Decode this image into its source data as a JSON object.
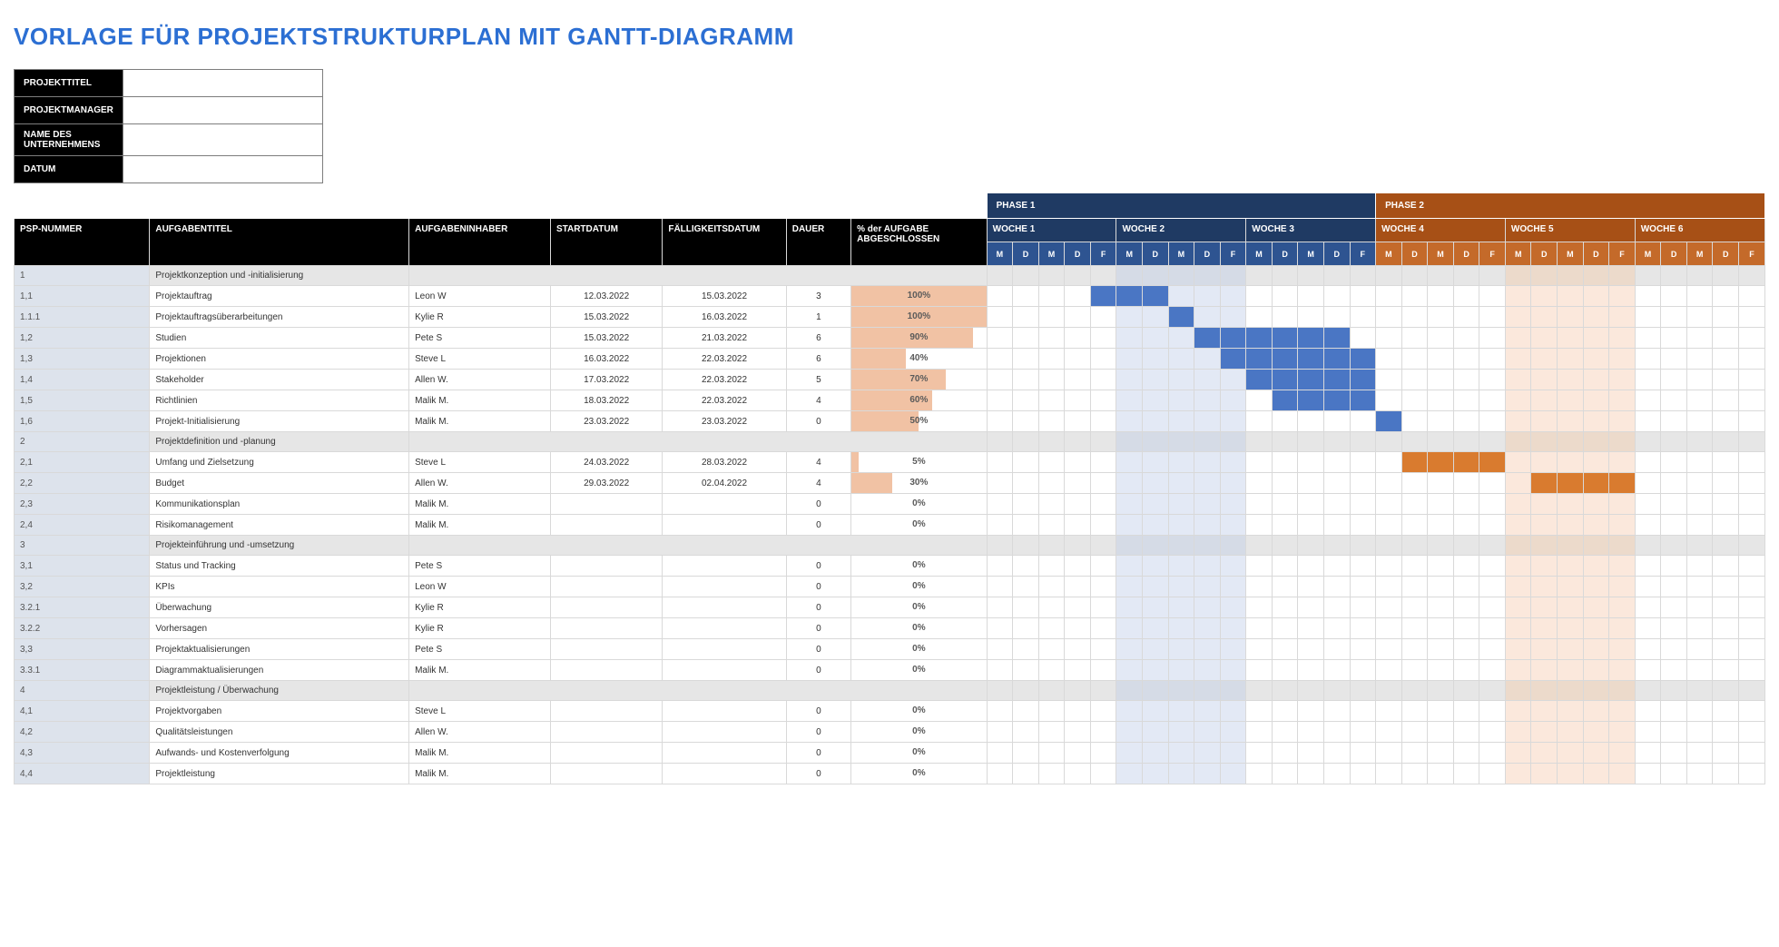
{
  "title": "VORLAGE FÜR PROJEKTSTRUKTURPLAN MIT GANTT-DIAGRAMM",
  "meta_labels": {
    "project_title": "PROJEKTTITEL",
    "project_manager": "PROJEKTMANAGER",
    "company_name": "NAME DES UNTERNEHMENS",
    "date": "DATUM"
  },
  "meta_values": {
    "project_title": "",
    "project_manager": "",
    "company_name": "",
    "date": ""
  },
  "phases": {
    "phase1": "PHASE 1",
    "phase2": "PHASE 2"
  },
  "columns": {
    "psp": "PSP-NUMMER",
    "task": "AUFGABENTITEL",
    "owner": "AUFGABENINHABER",
    "start": "STARTDATUM",
    "due": "FÄLLIGKEITSDATUM",
    "dur": "DAUER",
    "pct1": "% der AUFGABE",
    "pct2": "ABGESCHLOSSEN"
  },
  "weeks": [
    {
      "label": "WOCHE 1",
      "phase": 1
    },
    {
      "label": "WOCHE 2",
      "phase": 1
    },
    {
      "label": "WOCHE 3",
      "phase": 1
    },
    {
      "label": "WOCHE 4",
      "phase": 2
    },
    {
      "label": "WOCHE 5",
      "phase": 2
    },
    {
      "label": "WOCHE 6",
      "phase": 2
    }
  ],
  "days": [
    "M",
    "D",
    "M",
    "D",
    "F"
  ],
  "soft_shade_days": [
    5,
    6,
    7,
    8,
    9,
    20,
    21,
    22,
    23,
    24
  ],
  "rows": [
    {
      "psp": "1",
      "task": "Projektkonzeption und -initialisierung",
      "section": true
    },
    {
      "psp": "1,1",
      "task": "Projektauftrag",
      "owner": "Leon W",
      "start": "12.03.2022",
      "due": "15.03.2022",
      "dur": "3",
      "pct": 100,
      "fill": {
        "color": "blue",
        "start": 4,
        "end": 6
      }
    },
    {
      "psp": "1.1.1",
      "task": "Projektauftragsüberarbeitungen",
      "owner": "Kylie R",
      "start": "15.03.2022",
      "due": "16.03.2022",
      "dur": "1",
      "pct": 100,
      "fill": {
        "color": "blue",
        "start": 7,
        "end": 7
      }
    },
    {
      "psp": "1,2",
      "task": "Studien",
      "owner": "Pete S",
      "start": "15.03.2022",
      "due": "21.03.2022",
      "dur": "6",
      "pct": 90,
      "fill": {
        "color": "blue",
        "start": 8,
        "end": 13
      }
    },
    {
      "psp": "1,3",
      "task": "Projektionen",
      "owner": "Steve L",
      "start": "16.03.2022",
      "due": "22.03.2022",
      "dur": "6",
      "pct": 40,
      "fill": {
        "color": "blue",
        "start": 9,
        "end": 14
      }
    },
    {
      "psp": "1,4",
      "task": "Stakeholder",
      "owner": "Allen W.",
      "start": "17.03.2022",
      "due": "22.03.2022",
      "dur": "5",
      "pct": 70,
      "fill": {
        "color": "blue",
        "start": 10,
        "end": 14
      }
    },
    {
      "psp": "1,5",
      "task": "Richtlinien",
      "owner": "Malik M.",
      "start": "18.03.2022",
      "due": "22.03.2022",
      "dur": "4",
      "pct": 60,
      "fill": {
        "color": "blue",
        "start": 11,
        "end": 14
      }
    },
    {
      "psp": "1,6",
      "task": "Projekt-Initialisierung",
      "owner": "Malik M.",
      "start": "23.03.2022",
      "due": "23.03.2022",
      "dur": "0",
      "pct": 50,
      "fill": {
        "color": "blue",
        "start": 15,
        "end": 15
      }
    },
    {
      "psp": "2",
      "task": "Projektdefinition und -planung",
      "section": true
    },
    {
      "psp": "2,1",
      "task": "Umfang und Zielsetzung",
      "owner": "Steve L",
      "start": "24.03.2022",
      "due": "28.03.2022",
      "dur": "4",
      "pct": 5,
      "fill": {
        "color": "orange",
        "start": 16,
        "end": 19
      }
    },
    {
      "psp": "2,2",
      "task": "Budget",
      "owner": "Allen W.",
      "start": "29.03.2022",
      "due": "02.04.2022",
      "dur": "4",
      "pct": 30,
      "fill": {
        "color": "orange",
        "start": 21,
        "end": 24
      }
    },
    {
      "psp": "2,3",
      "task": "Kommunikationsplan",
      "owner": "Malik M.",
      "start": "",
      "due": "",
      "dur": "0",
      "pct": 0
    },
    {
      "psp": "2,4",
      "task": "Risikomanagement",
      "owner": "Malik M.",
      "start": "",
      "due": "",
      "dur": "0",
      "pct": 0
    },
    {
      "psp": "3",
      "task": "Projekteinführung und -umsetzung",
      "section": true
    },
    {
      "psp": "3,1",
      "task": "Status und Tracking",
      "owner": "Pete S",
      "start": "",
      "due": "",
      "dur": "0",
      "pct": 0
    },
    {
      "psp": "3,2",
      "task": "KPIs",
      "owner": "Leon W",
      "start": "",
      "due": "",
      "dur": "0",
      "pct": 0
    },
    {
      "psp": "3.2.1",
      "task": "Überwachung",
      "owner": "Kylie R",
      "start": "",
      "due": "",
      "dur": "0",
      "pct": 0
    },
    {
      "psp": "3.2.2",
      "task": "Vorhersagen",
      "owner": "Kylie R",
      "start": "",
      "due": "",
      "dur": "0",
      "pct": 0
    },
    {
      "psp": "3,3",
      "task": "Projektaktualisierungen",
      "owner": "Pete S",
      "start": "",
      "due": "",
      "dur": "0",
      "pct": 0
    },
    {
      "psp": "3.3.1",
      "task": "Diagrammaktualisierungen",
      "owner": "Malik M.",
      "start": "",
      "due": "",
      "dur": "0",
      "pct": 0
    },
    {
      "psp": "4",
      "task": "Projektleistung / Überwachung",
      "section": true
    },
    {
      "psp": "4,1",
      "task": "Projektvorgaben",
      "owner": "Steve L",
      "start": "",
      "due": "",
      "dur": "0",
      "pct": 0
    },
    {
      "psp": "4,2",
      "task": "Qualitätsleistungen",
      "owner": "Allen W.",
      "start": "",
      "due": "",
      "dur": "0",
      "pct": 0
    },
    {
      "psp": "4,3",
      "task": "Aufwands- und Kostenverfolgung",
      "owner": "Malik M.",
      "start": "",
      "due": "",
      "dur": "0",
      "pct": 0
    },
    {
      "psp": "4,4",
      "task": "Projektleistung",
      "owner": "Malik M.",
      "start": "",
      "due": "",
      "dur": "0",
      "pct": 0
    }
  ]
}
